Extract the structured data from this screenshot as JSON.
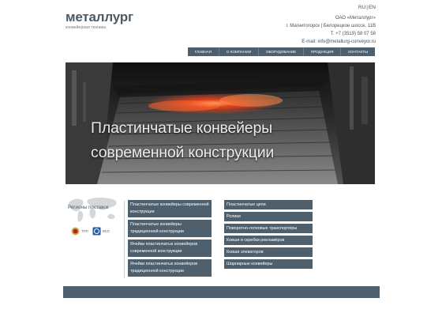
{
  "brand": {
    "name": "металлург",
    "tagline": "конвейерная техника"
  },
  "lang": {
    "ru": "RU",
    "sep": "|",
    "en": "EN"
  },
  "contacts": {
    "company": "ОАО «Металлург»",
    "address": "г. Магнитогорск | Белорецкое шоссе, 11В",
    "phone": "Т. +7 (3519) 58 07 58",
    "email": "E-mail: info@metallurg-conveyor.ru"
  },
  "nav": [
    "Главная",
    "О компании",
    "Оборудование",
    "Продукция",
    "Контакты"
  ],
  "hero": {
    "line1": "Пластинчатые конвейеры",
    "line2": "современной конструкции"
  },
  "regions": {
    "title": "Регионы поставок"
  },
  "certs": {
    "tpp": "ТПП",
    "iso": "ИСО"
  },
  "col1": [
    "Пластинчатые конвейеры современной конструкции",
    "Пластинчатые конвейеры традиционной конструкции",
    "Ячейки пластинчатых конвейеров современной конструкции",
    "Ячейки пластинчатых конвейеров традиционной конструкции"
  ],
  "col2": [
    "Пластинчатые цепи",
    "Ролики",
    "Поворотно-лотковые транспортёры",
    "Ковши и скребки рекламёров",
    "Ковши элеваторов",
    "Шарнирные конвейеры"
  ],
  "colors": {
    "accent": "#4e606e",
    "background": "#ffffff"
  }
}
